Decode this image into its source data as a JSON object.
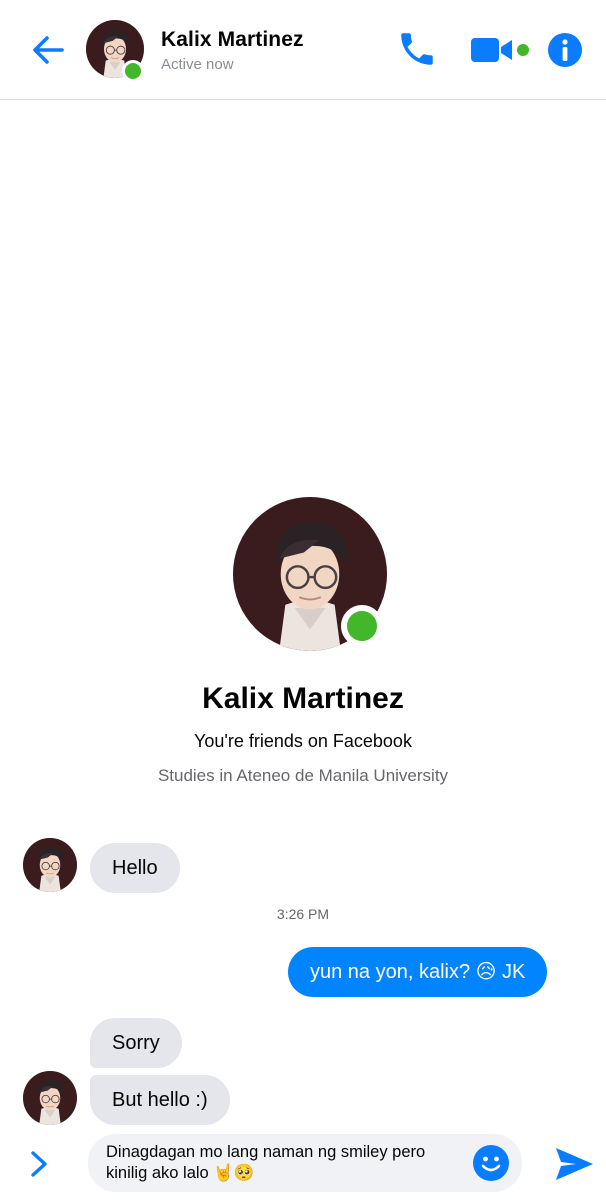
{
  "header": {
    "contact_name": "Kalix Martinez",
    "status": "Active now",
    "icons": [
      "back-arrow-icon",
      "phone-icon",
      "video-camera-icon",
      "info-icon"
    ]
  },
  "profile": {
    "name": "Kalix Martinez",
    "friends_line": "You're friends on Facebook",
    "studies_line": "Studies in Ateneo de Manila University"
  },
  "messages": {
    "m1": "Hello",
    "timestamp": "3:26 PM",
    "m2": "yun na yon, kalix? 😥 JK",
    "m3": "Sorry",
    "m4": "But hello :)"
  },
  "composer": {
    "value": "Dinagdagan mo lang naman ng smiley pero kinilig ako lalo 🤘🥺",
    "icons": [
      "chevron-right-icon",
      "smiley-icon",
      "send-icon"
    ]
  },
  "colors": {
    "accent": "#0084ff",
    "active_dot": "#42b72a",
    "incoming_bubble": "#e4e6eb"
  }
}
